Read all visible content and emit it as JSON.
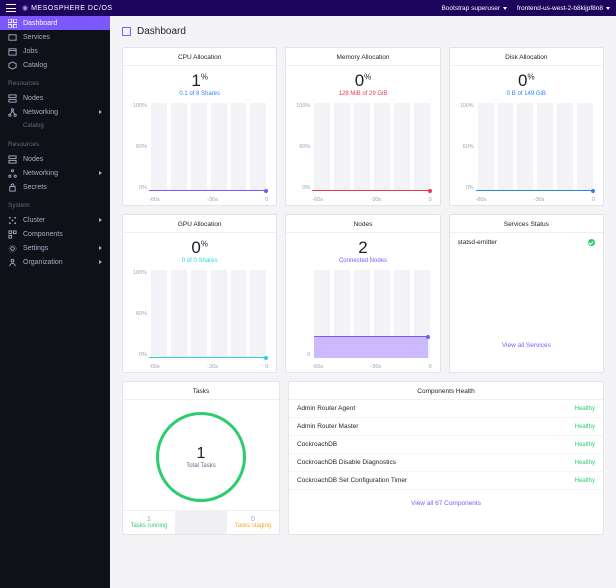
{
  "topbar": {
    "logo": "MESOSPHERE DC/OS",
    "user": "Bootstrap superuser",
    "cluster": "frontend-us-west-2-b8kijpf8n8"
  },
  "sidebar": {
    "main": [
      {
        "label": "Dashboard",
        "icon": "grid"
      },
      {
        "label": "Services",
        "icon": "box"
      },
      {
        "label": "Jobs",
        "icon": "calendar"
      },
      {
        "label": "Catalog",
        "icon": "package"
      }
    ],
    "section_resources": "Resources",
    "resources": [
      {
        "label": "Nodes",
        "icon": "servers"
      },
      {
        "label": "Networking",
        "icon": "network",
        "carrot": true
      },
      {
        "label": "Nodes",
        "icon": "servers"
      },
      {
        "label": "Networking",
        "icon": "network",
        "carrot": true
      },
      {
        "label": "Secrets",
        "icon": "lock"
      }
    ],
    "section_system": "System",
    "system": [
      {
        "label": "Cluster",
        "icon": "cluster",
        "carrot": true
      },
      {
        "label": "Components",
        "icon": "components"
      },
      {
        "label": "Settings",
        "icon": "gear",
        "carrot": true
      },
      {
        "label": "Organization",
        "icon": "org",
        "carrot": true
      }
    ]
  },
  "header": {
    "title": "Dashboard"
  },
  "cards": {
    "cpu": {
      "title": "CPU Allocation",
      "value": "1",
      "unit": "%",
      "sub": "0.1 of 8 Shares"
    },
    "mem": {
      "title": "Memory Allocation",
      "value": "0",
      "unit": "%",
      "sub": "128 MiB of 29 GiB"
    },
    "disk": {
      "title": "Disk Allocation",
      "value": "0",
      "unit": "%",
      "sub": "0 B of 149 GiB"
    },
    "gpu": {
      "title": "GPU Allocation",
      "value": "0",
      "unit": "%",
      "sub": "0 of 0 Shares"
    },
    "nodes": {
      "title": "Nodes",
      "value": "2",
      "sub": "Connected Nodes"
    },
    "services": {
      "title": "Services Status",
      "items": [
        {
          "name": "statsd-emitter",
          "status": "healthy"
        }
      ],
      "view_all": "View all Services"
    },
    "tasks": {
      "title": "Tasks",
      "total": "1",
      "total_label": "Total Tasks",
      "running": "1",
      "running_label": "Tasks running",
      "staging": "0",
      "staging_label": "Tasks staging"
    },
    "components": {
      "title": "Components Health",
      "items": [
        {
          "name": "Admin Router Agent",
          "status": "Healthy"
        },
        {
          "name": "Admin Router Master",
          "status": "Healthy"
        },
        {
          "name": "CockroachDB",
          "status": "Healthy"
        },
        {
          "name": "CockroachDB Disable Diagnostics",
          "status": "Healthy"
        },
        {
          "name": "CockroachDB Set Configuration Timer",
          "status": "Healthy"
        }
      ],
      "view_all": "View all 67 Components"
    }
  },
  "chart": {
    "y": [
      "100%",
      "60%",
      "0%"
    ],
    "x": [
      "-60s",
      "-30s",
      "0"
    ]
  },
  "chart_data": [
    {
      "type": "area",
      "title": "CPU Allocation",
      "ylabel": "%",
      "ylim": [
        0,
        100
      ],
      "x": [
        -60,
        -30,
        0
      ],
      "values": [
        1,
        1,
        1
      ],
      "color": "#7d58ff"
    },
    {
      "type": "area",
      "title": "Memory Allocation",
      "ylabel": "%",
      "ylim": [
        0,
        100
      ],
      "x": [
        -60,
        -30,
        0
      ],
      "values": [
        0,
        0,
        0
      ],
      "color": "#e73c4e"
    },
    {
      "type": "area",
      "title": "Disk Allocation",
      "ylabel": "%",
      "ylim": [
        0,
        100
      ],
      "x": [
        -60,
        -30,
        0
      ],
      "values": [
        0,
        0,
        0
      ],
      "color": "#2f81f7"
    },
    {
      "type": "area",
      "title": "GPU Allocation",
      "ylabel": "%",
      "ylim": [
        0,
        100
      ],
      "x": [
        -60,
        -30,
        0
      ],
      "values": [
        0,
        0,
        0
      ],
      "color": "#29d6d6"
    },
    {
      "type": "area",
      "title": "Nodes",
      "ylabel": "count",
      "x": [
        -60,
        -30,
        0
      ],
      "values": [
        2,
        2,
        2
      ],
      "color": "#7d58ff"
    },
    {
      "type": "pie",
      "title": "Tasks",
      "categories": [
        "Tasks running",
        "Tasks staging"
      ],
      "values": [
        1,
        0
      ]
    }
  ]
}
